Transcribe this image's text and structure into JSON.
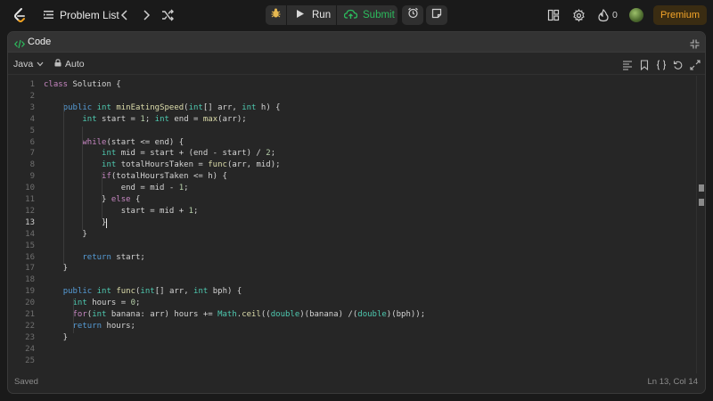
{
  "topbar": {
    "problem_list_label": "Problem List",
    "run_label": "Run",
    "submit_label": "Submit",
    "streak_count": "0",
    "premium_label": "Premium"
  },
  "panel": {
    "title": "Code",
    "language": "Java",
    "autocomplete_label": "Auto"
  },
  "editor": {
    "active_line": 13,
    "lines": [
      "class Solution {",
      "",
      "    public int minEatingSpeed(int[] arr, int h) {",
      "        int start = 1; int end = max(arr);",
      "",
      "        while(start <= end) {",
      "            int mid = start + (end - start) / 2;",
      "            int totalHoursTaken = func(arr, mid);",
      "            if(totalHoursTaken <= h) {",
      "                end = mid - 1;",
      "            } else {",
      "                start = mid + 1;",
      "            }",
      "        }",
      "",
      "        return start;",
      "    }",
      "",
      "    public int func(int[] arr, int bph) {",
      "      int hours = 0;",
      "      for(int banana: arr) hours += Math.ceil((double)(banana) /(double)(bph));",
      "      return hours;",
      "    }",
      "",
      ""
    ]
  },
  "status": {
    "saved_text": "Saved",
    "cursor_position": "Ln 13, Col 14"
  },
  "colors": {
    "accent_green": "#2cbb5d",
    "premium_orange": "#f4a529",
    "keyword_blue": "#569cd6",
    "type_teal": "#4ec9b0",
    "function_yellow": "#dcdcaa"
  },
  "icons": [
    "logo-icon",
    "list-icon",
    "chevron-left-icon",
    "chevron-right-icon",
    "shuffle-icon",
    "bug-icon",
    "play-icon",
    "cloud-upload-icon",
    "alarm-icon",
    "note-icon",
    "layout-icon",
    "gear-icon",
    "fire-icon",
    "code-icon",
    "collapse-icon",
    "chevron-down-icon",
    "lock-icon",
    "format-icon",
    "bookmark-icon",
    "braces-icon",
    "reset-icon",
    "fullscreen-icon"
  ]
}
